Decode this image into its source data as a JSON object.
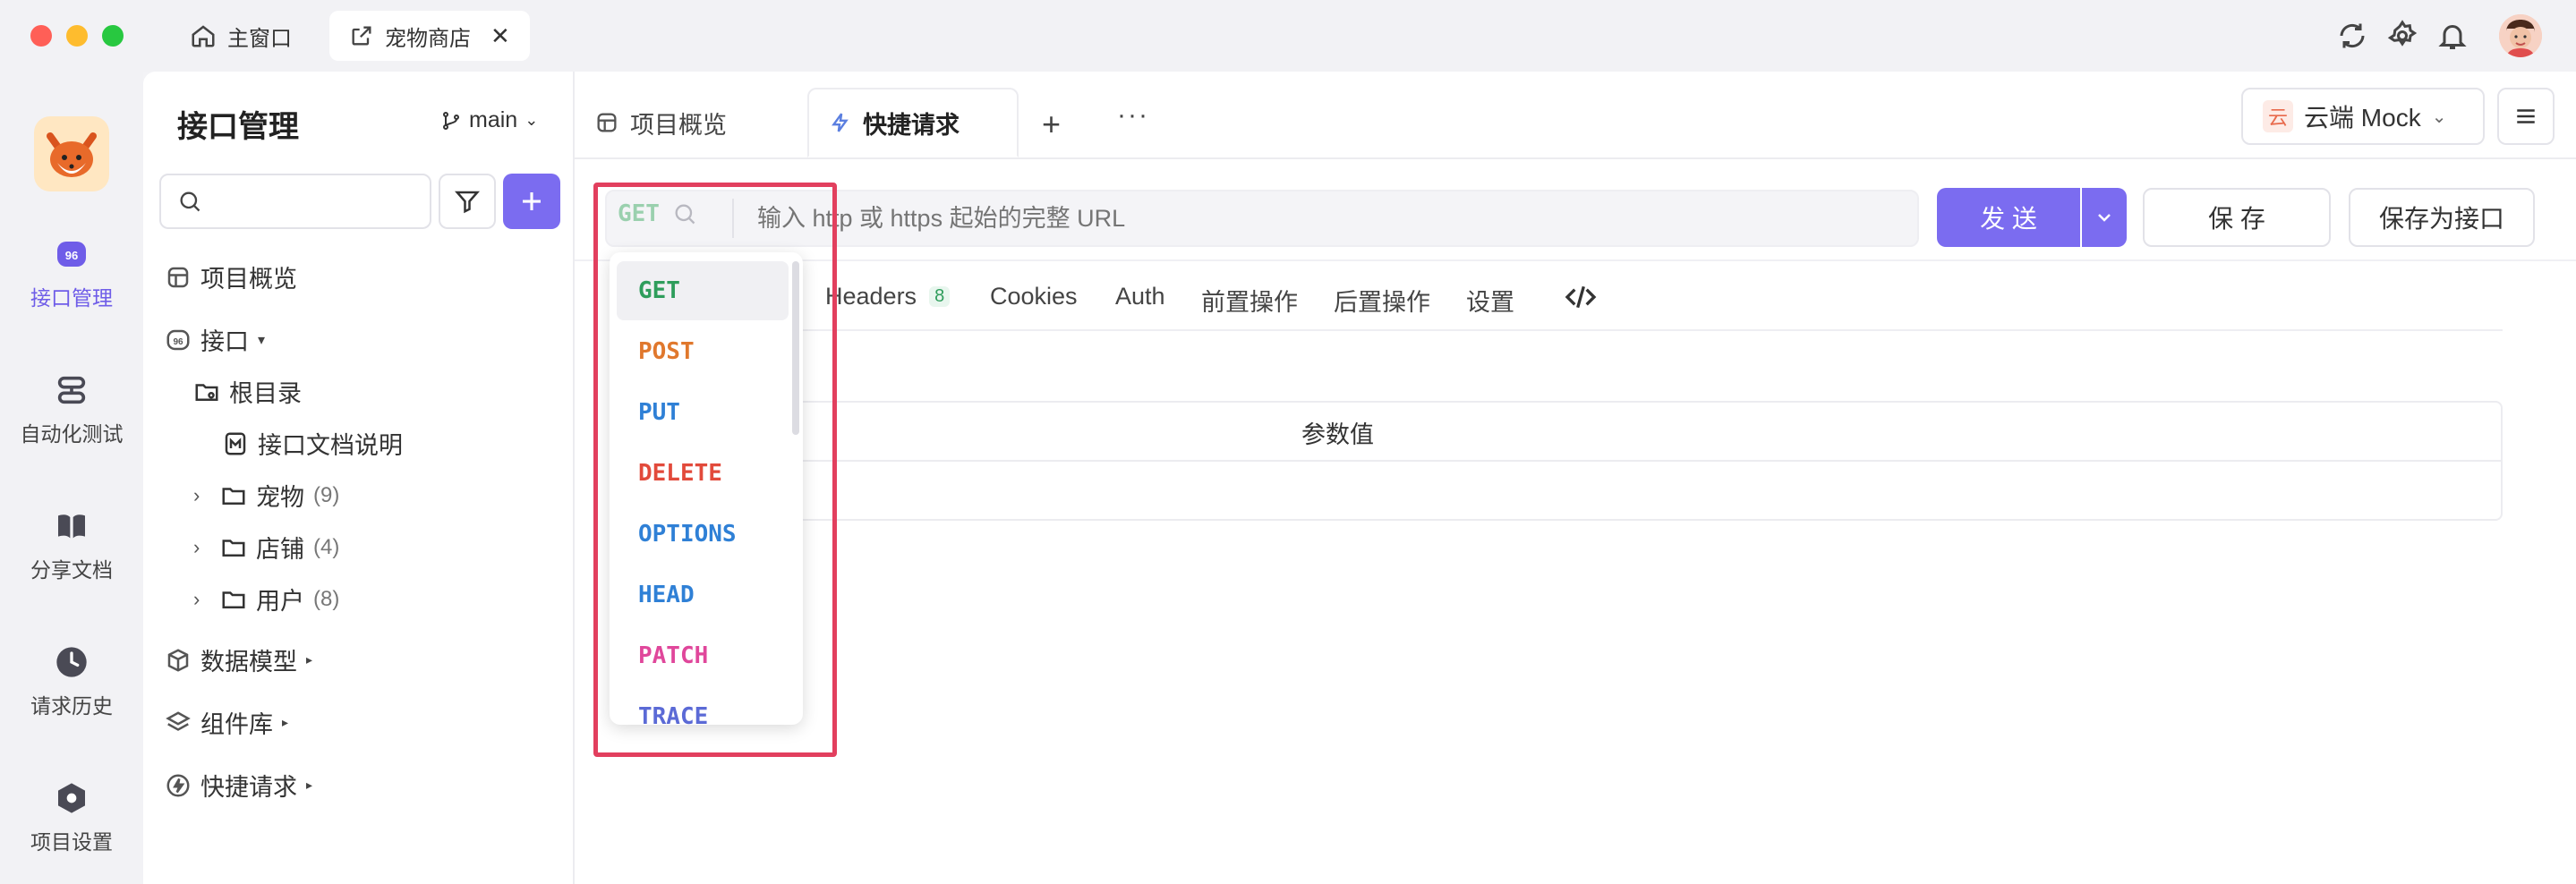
{
  "window": {
    "tabs": [
      {
        "label": "主窗口",
        "icon": "home-icon"
      },
      {
        "label": "宠物商店",
        "icon": "external-link-icon"
      }
    ]
  },
  "rail": {
    "items": [
      {
        "label": "接口管理",
        "icon": "api-icon",
        "active": true
      },
      {
        "label": "自动化测试",
        "icon": "stack-icon"
      },
      {
        "label": "分享文档",
        "icon": "book-icon"
      },
      {
        "label": "请求历史",
        "icon": "clock-icon"
      },
      {
        "label": "项目设置",
        "icon": "hex-settings-icon"
      }
    ]
  },
  "sidebar": {
    "title": "接口管理",
    "branch": "main",
    "search": {
      "placeholder": "",
      "value": ""
    },
    "tree": {
      "overview": "项目概览",
      "apis": "接口",
      "root": "根目录",
      "doc": "接口文档说明",
      "folders": [
        {
          "label": "宠物",
          "count": "(9)"
        },
        {
          "label": "店铺",
          "count": "(4)"
        },
        {
          "label": "用户",
          "count": "(8)"
        }
      ],
      "models": "数据模型",
      "components": "组件库",
      "quick": "快捷请求"
    }
  },
  "main": {
    "tabs": [
      {
        "label": "项目概览"
      },
      {
        "label": "快捷请求",
        "active": true
      }
    ],
    "env": {
      "badge": "云",
      "label": "云端 Mock"
    },
    "request": {
      "method": "GET",
      "url_placeholder": "输入 http 或 https 起始的完整 URL",
      "send": "发 送",
      "save": "保 存",
      "save_as": "保存为接口"
    },
    "subtabs": [
      {
        "label": "Headers",
        "badge": "8"
      },
      {
        "label": "Cookies"
      },
      {
        "label": "Auth"
      },
      {
        "label": "前置操作"
      },
      {
        "label": "后置操作"
      },
      {
        "label": "设置"
      }
    ],
    "table": {
      "header_value": "参数值"
    },
    "methods": [
      {
        "label": "GET",
        "color": "#2e9d5b"
      },
      {
        "label": "POST",
        "color": "#e0782d"
      },
      {
        "label": "PUT",
        "color": "#2f80d6"
      },
      {
        "label": "DELETE",
        "color": "#e24a3b"
      },
      {
        "label": "OPTIONS",
        "color": "#2f80d6"
      },
      {
        "label": "HEAD",
        "color": "#2f80d6"
      },
      {
        "label": "PATCH",
        "color": "#e0479b"
      },
      {
        "label": "TRACE",
        "color": "#5b6ad6"
      }
    ]
  },
  "colors": {
    "accent": "#7b6cf0",
    "highlight": "#e23f5e"
  }
}
